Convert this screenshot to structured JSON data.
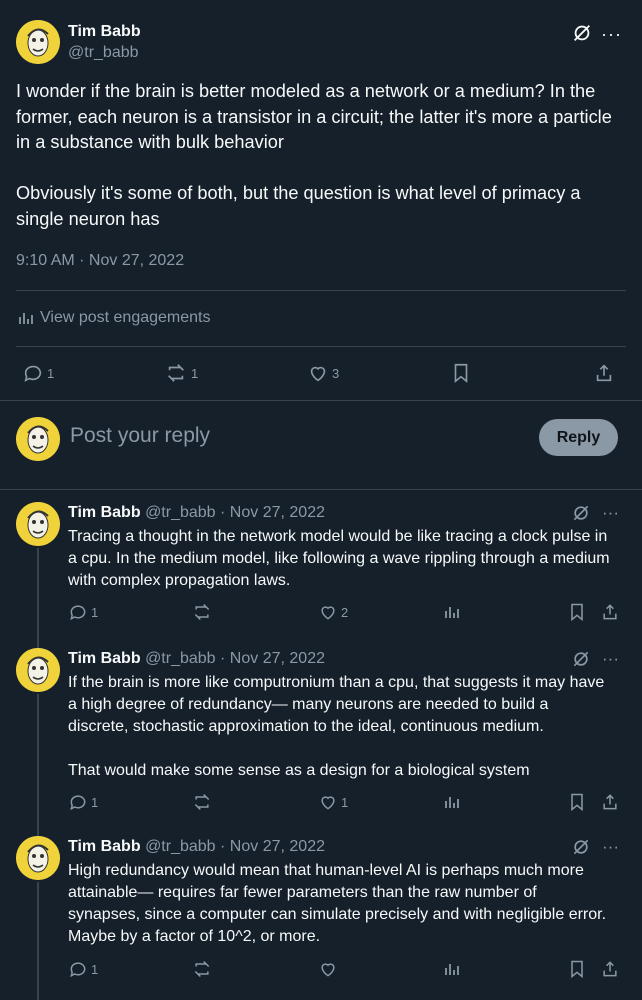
{
  "main_tweet": {
    "author_name": "Tim Babb",
    "handle": "@tr_babb",
    "text": "I wonder if the brain is better modeled as a network or a medium? In the former, each neuron is a transistor in a circuit; the latter it's more a particle in a substance with bulk behavior\n\nObviously it's some of both, but the question is what level of primacy a single neuron has",
    "timestamp": "9:10 AM · Nov 27, 2022",
    "engagements_label": "View post engagements",
    "replies": "1",
    "reposts": "1",
    "likes": "3"
  },
  "reply_box": {
    "placeholder": "Post your reply",
    "button_label": "Reply"
  },
  "thread": [
    {
      "author_name": "Tim Babb",
      "handle": "@tr_babb",
      "date": "· Nov 27, 2022",
      "text": "Tracing a thought in the network model would be like tracing a clock pulse in a cpu. In the medium model, like following a wave rippling through a medium with complex propagation laws.",
      "replies": "1",
      "reposts": "",
      "likes": "2"
    },
    {
      "author_name": "Tim Babb",
      "handle": "@tr_babb",
      "date": "· Nov 27, 2022",
      "text": "If the brain is more like computronium than a cpu, that suggests it may have a high degree of redundancy— many neurons are needed to build a discrete, stochastic approximation to the ideal, continuous medium.\n\nThat would make some sense as a design for a biological system",
      "replies": "1",
      "reposts": "",
      "likes": "1"
    },
    {
      "author_name": "Tim Babb",
      "handle": "@tr_babb",
      "date": "· Nov 27, 2022",
      "text": "High redundancy would mean that human-level AI is perhaps much more attainable— requires far fewer parameters than the raw number of synapses, since a computer can simulate precisely and with negligible error. Maybe by a factor of 10^2, or more.",
      "replies": "1",
      "reposts": "",
      "likes": ""
    }
  ],
  "colors": {
    "background": "#15202b",
    "text": "#f7f9f9",
    "muted": "#8b98a5",
    "divider": "#38444d",
    "avatar": "#f0d23a"
  }
}
